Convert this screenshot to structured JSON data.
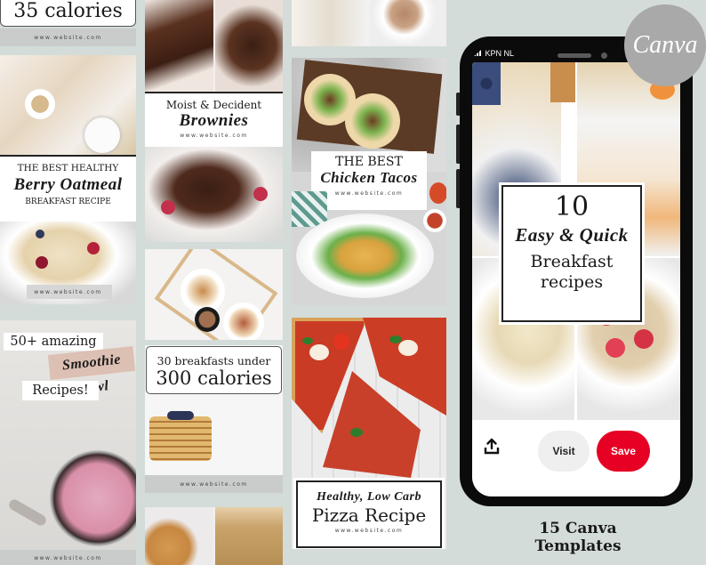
{
  "brand": {
    "logo_text": "Canva",
    "accent_red": "#e60023",
    "bg": "#d3dcd8"
  },
  "website_label": "www.website.com",
  "column1": {
    "card1": {
      "title": "35 calories",
      "website": "www.website.com"
    },
    "card2": {
      "line1": "THE BEST HEALTHY",
      "line2": "Berry Oatmeal",
      "line3": "BREAKFAST RECIPE",
      "website": "www.website.com"
    },
    "card3": {
      "line1": "50+ amazing",
      "line2": "Smoothie bowl",
      "line3": "Recipes!",
      "website": "www.website.com"
    }
  },
  "column2": {
    "card1": {
      "line1": "Moist & Decident",
      "line2": "Brownies",
      "website": "www.website.com"
    },
    "card2": {
      "line1": "30 breakfasts under",
      "line2": "300 calories",
      "website": "www.website.com"
    }
  },
  "column3": {
    "card1": {
      "line1": "THE BEST",
      "line2": "Chicken Tacos",
      "website": "www.website.com"
    },
    "card2": {
      "line1": "Healthy, Low Carb",
      "line2": "Pizza Recipe",
      "website": "www.website.com"
    }
  },
  "phone": {
    "carrier": "KPN NL",
    "pin": {
      "number": "10",
      "line1": "Easy & Quick",
      "line2": "Breakfast",
      "line3": "recipes"
    },
    "actions": {
      "visit_label": "Visit",
      "save_label": "Save",
      "share_icon": "share-icon"
    }
  },
  "footer": {
    "line1": "15 Canva",
    "line2": "Templates"
  }
}
